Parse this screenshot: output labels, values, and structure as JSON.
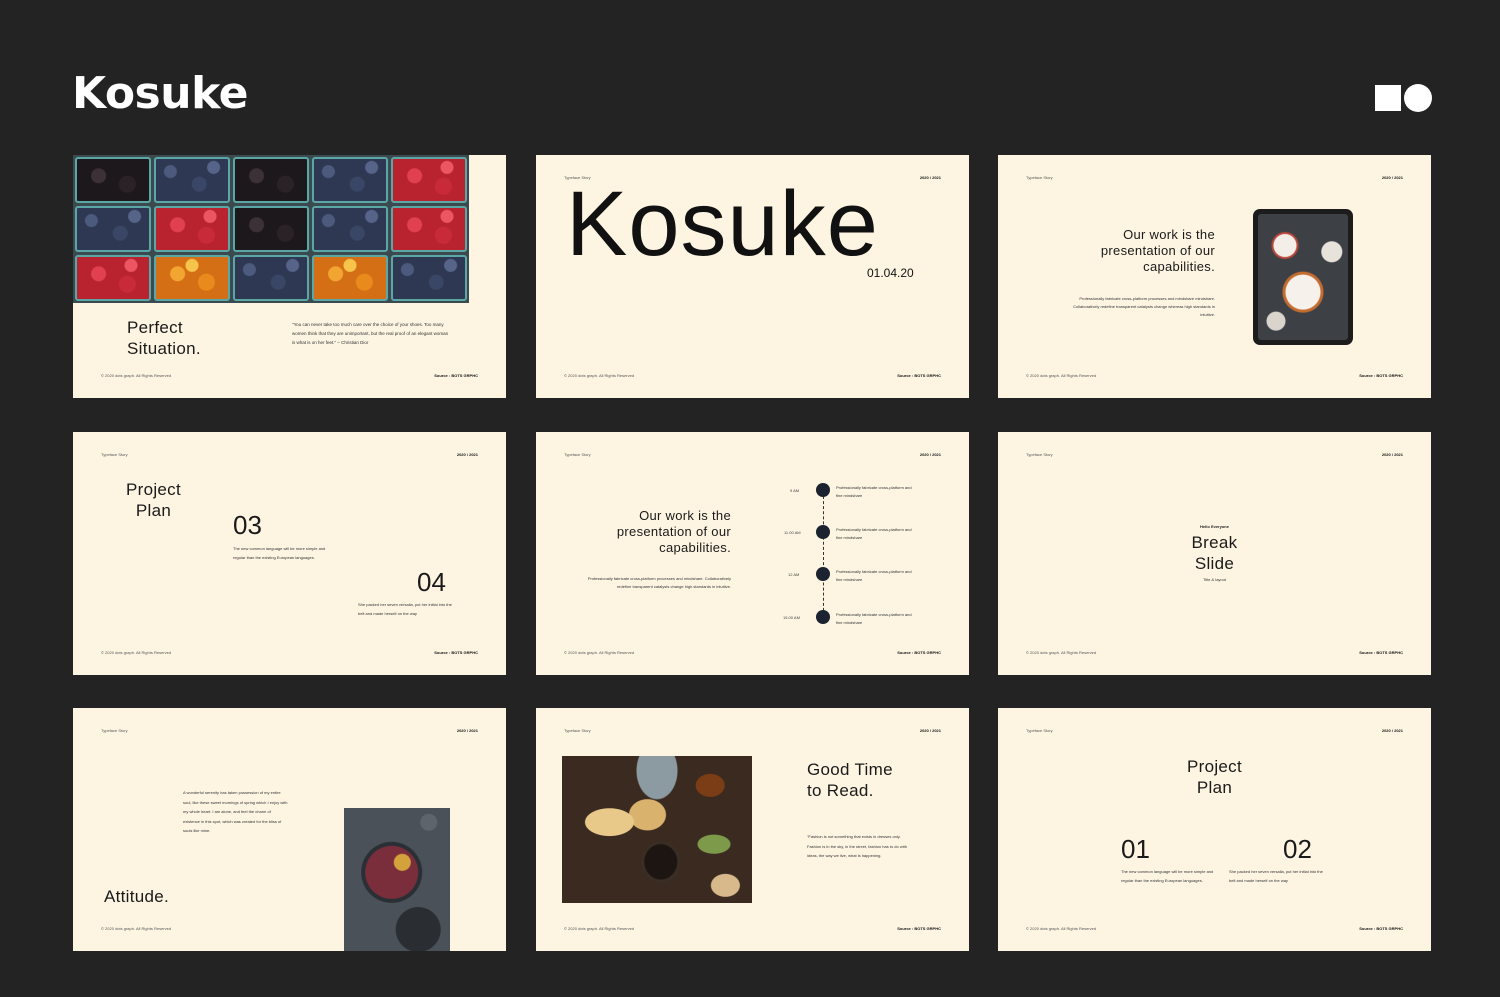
{
  "brand": {
    "name": "Kosuke"
  },
  "slides": [
    {
      "title_line1": "Perfect",
      "title_line2": "Situation.",
      "quote": "\"You can never take too much care over the choice of your shoes. Too many women think that they are unimportant, but the real proof of an elegant woman is what is on her feet.\" – Christian Dior",
      "footer_left": "© 2020 dots graph. All Rights Reserved",
      "footer_right": "Source : BOTS GRPHC"
    },
    {
      "header_left": "Typeface Story",
      "header_right": "2020 / 2021",
      "big_title": "Kosuke",
      "date": "01.04.20",
      "footer_left": "© 2020 dots graph. All Rights Reserved",
      "footer_right": "Source : BOTS GRPHC"
    },
    {
      "header_left": "Typeface Story",
      "header_right": "2020 / 2021",
      "title_line1": "Our work is the",
      "title_line2": "presentation of our",
      "title_line3": "capabilities.",
      "body": "Professionally fabricate cross-platform processes and mindshare mindshare. Collaboratively redefine transparent catalysts change whereas high standards in intuitive.",
      "footer_left": "© 2020 dots graph. All Rights Reserved",
      "footer_right": "Source : BOTS GRPHC"
    },
    {
      "header_left": "Typeface Story",
      "header_right": "2020 / 2021",
      "title_line1": "Project",
      "title_line2": "Plan",
      "num_a": "03",
      "text_a": "The new common language will be more simple and regular than the existing European languages.",
      "num_b": "04",
      "text_b": "She packed her seven versalia, put her initial into the belt and made herself on the way",
      "footer_left": "© 2020 dots graph. All Rights Reserved",
      "footer_right": "Source : BOTS GRPHC"
    },
    {
      "header_left": "Typeface Story",
      "header_right": "2020 / 2021",
      "title_line1": "Our work is the",
      "title_line2": "presentation of our",
      "title_line3": "capabilities.",
      "body": "Professionally fabricate cross-platform processes and mindshare. Collaboratively redefine transparent catalysts change high standards in intuitive.",
      "timeline": [
        {
          "time": "9 AM",
          "text": "Professionally fabricate cross-platform and fine mindshare"
        },
        {
          "time": "11.00 AM",
          "text": "Professionally fabricate cross-platform and fine mindshare"
        },
        {
          "time": "12 AM",
          "text": "Professionally fabricate cross-platform and fine mindshare"
        },
        {
          "time": "15.00 AM",
          "text": "Professionally fabricate cross-platform and fine mindshare"
        }
      ],
      "footer_left": "© 2020 dots graph. All Rights Reserved",
      "footer_right": "Source : BOTS GRPHC"
    },
    {
      "header_left": "Typeface Story",
      "header_right": "2020 / 2021",
      "kicker": "Hello Everyone",
      "title_line1": "Break",
      "title_line2": "Slide",
      "sub": "Title & layout",
      "footer_left": "© 2020 dots graph. All Rights Reserved",
      "footer_right": "Source : BOTS GRPHC"
    },
    {
      "header_left": "Typeface Story",
      "header_right": "2020 / 2021",
      "body": "A wonderful serenity has taken possession of my entire soul, like these sweet mornings of spring which I enjoy with my whole heart. I am alone, and feel the charm of existence in this spot, which was created for the bliss of souls like mine.",
      "title": "Attitude.",
      "footer_left": "© 2020 dots graph. All Rights Reserved"
    },
    {
      "header_left": "Typeface Story",
      "header_right": "2020 / 2021",
      "title_line1": "Good Time",
      "title_line2": "to Read.",
      "body": "\"Fashion is not something that exists in dresses only. Fashion is in the sky, in the street, fashion has to do with ideas, the way we live, what is happening.",
      "footer_left": "© 2020 dots graph. All Rights Reserved",
      "footer_right": "Source : BOTS GRPHC"
    },
    {
      "header_left": "Typeface Story",
      "header_right": "2020 / 2021",
      "title_line1": "Project",
      "title_line2": "Plan",
      "num_a": "01",
      "text_a": "The new common language will be more simple and regular than the existing European languages.",
      "num_b": "02",
      "text_b": "She packed her seven versalia, put her initial into the belt and made herself on the way",
      "footer_left": "© 2020 dots graph. All Rights Reserved",
      "footer_right": "Source : BOTS GRPHC"
    }
  ],
  "icons": {
    "logo_mark": "square-circle-logo-icon"
  }
}
